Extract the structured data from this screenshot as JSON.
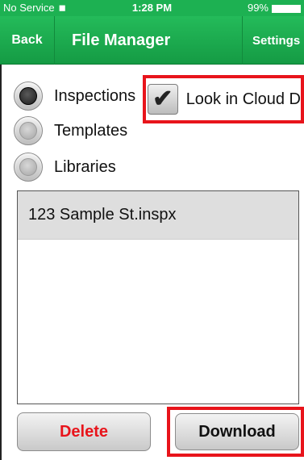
{
  "status_bar": {
    "carrier": "No Service",
    "time": "1:28 PM",
    "battery": "99%"
  },
  "nav": {
    "back_label": "Back",
    "title": "File Manager",
    "settings_label": "Settings"
  },
  "file_types": [
    {
      "label": "Inspections",
      "selected": true
    },
    {
      "label": "Templates",
      "selected": false
    },
    {
      "label": "Libraries",
      "selected": false
    }
  ],
  "cloud_checkbox": {
    "label": "Look in Cloud D",
    "checked": true
  },
  "files": [
    {
      "name": "123 Sample St.inspx"
    }
  ],
  "actions": {
    "delete_label": "Delete",
    "download_label": "Download"
  },
  "colors": {
    "nav_green": "#1db152",
    "delete_red": "#e8141b",
    "highlight_red": "#e8141b"
  }
}
